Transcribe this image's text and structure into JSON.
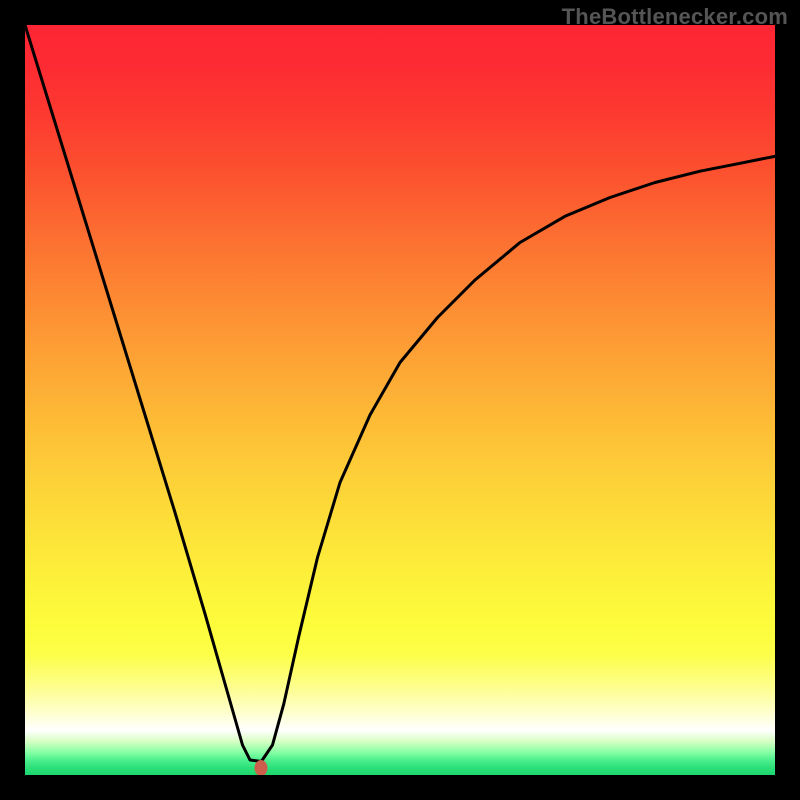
{
  "watermark": "TheBottlenecker.com",
  "chart_data": {
    "type": "line",
    "title": "",
    "xlabel": "",
    "ylabel": "",
    "xlim": [
      0,
      1
    ],
    "ylim": [
      0,
      1
    ],
    "description": "V-shaped bottleneck curve over rainbow vertical gradient (red at top = high bottleneck, green at bottom = 0%). Vertex marks the optimal match point.",
    "series": [
      {
        "name": "bottleneck-curve",
        "x": [
          0.0,
          0.04,
          0.08,
          0.12,
          0.16,
          0.2,
          0.24,
          0.27,
          0.29,
          0.3,
          0.315,
          0.33,
          0.345,
          0.365,
          0.39,
          0.42,
          0.46,
          0.5,
          0.55,
          0.6,
          0.66,
          0.72,
          0.78,
          0.84,
          0.9,
          0.95,
          1.0
        ],
        "y": [
          1.0,
          0.87,
          0.74,
          0.61,
          0.48,
          0.35,
          0.215,
          0.11,
          0.04,
          0.02,
          0.018,
          0.04,
          0.095,
          0.185,
          0.29,
          0.39,
          0.48,
          0.55,
          0.61,
          0.66,
          0.71,
          0.745,
          0.77,
          0.79,
          0.805,
          0.815,
          0.825
        ]
      }
    ],
    "vertex": {
      "x": 0.315,
      "y": 0.01,
      "color": "#cb5f4b"
    },
    "gradient_stops": [
      {
        "pos": 0.0,
        "color": "#fd2634"
      },
      {
        "pos": 0.5,
        "color": "#fdb037"
      },
      {
        "pos": 0.8,
        "color": "#fdfc3b"
      },
      {
        "pos": 0.94,
        "color": "#ffffff"
      },
      {
        "pos": 1.0,
        "color": "#1bd76e"
      }
    ]
  }
}
